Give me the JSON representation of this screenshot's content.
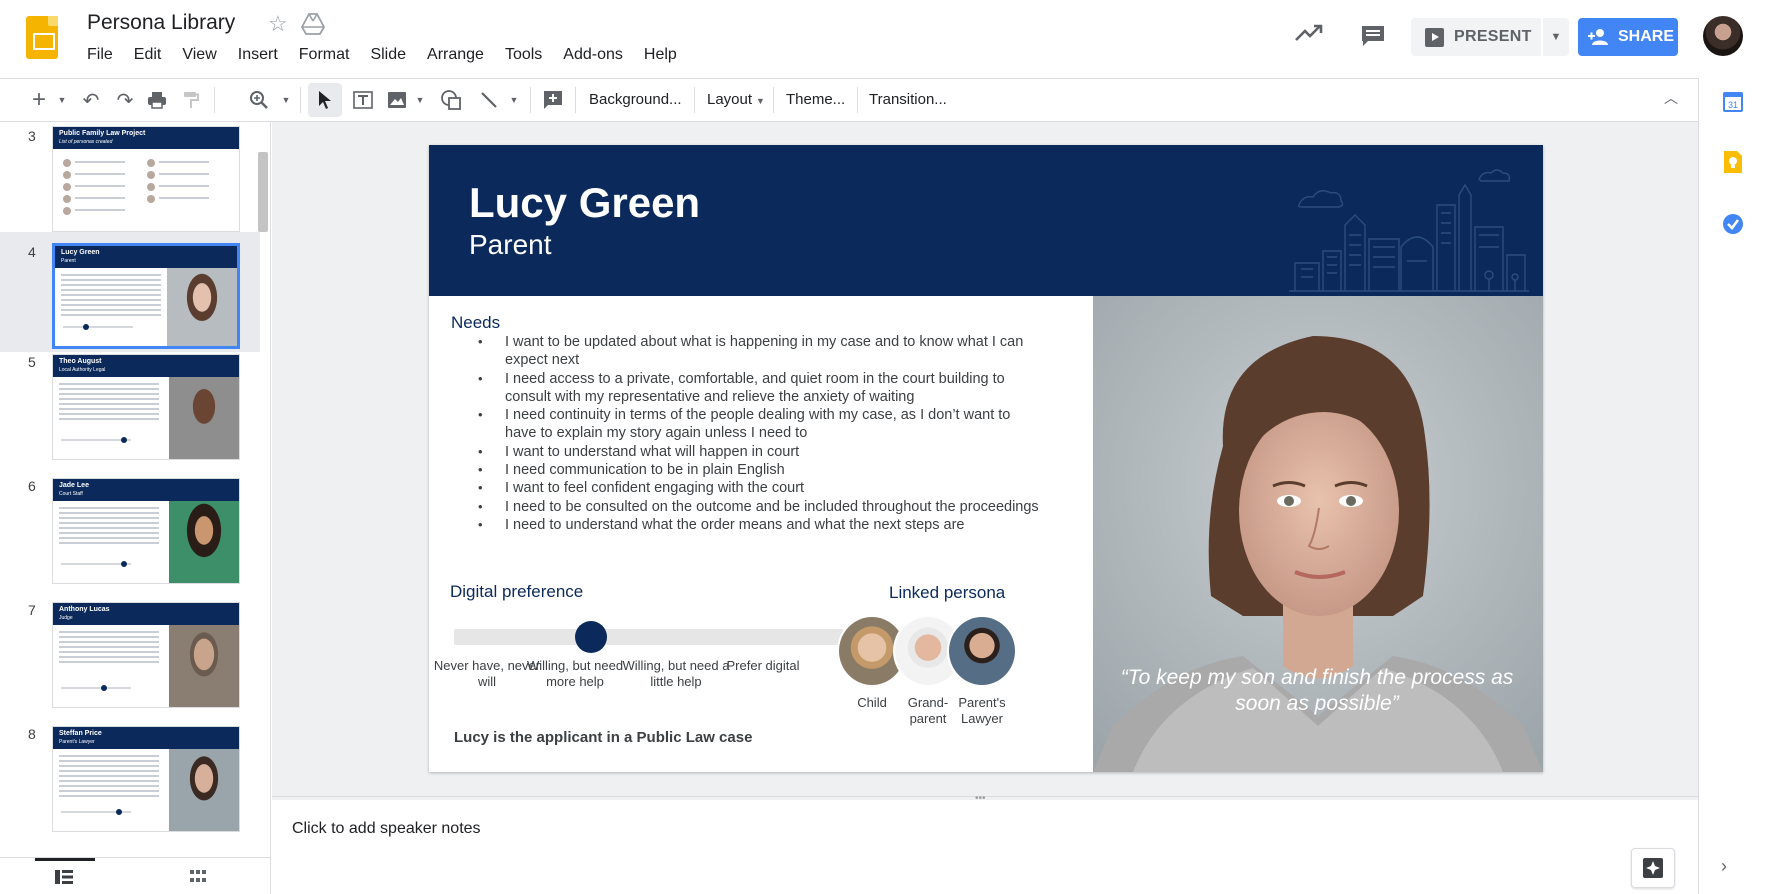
{
  "header": {
    "title": "Persona Library",
    "menu": [
      "File",
      "Edit",
      "View",
      "Insert",
      "Format",
      "Slide",
      "Arrange",
      "Tools",
      "Add-ons",
      "Help"
    ],
    "present_label": "PRESENT",
    "share_label": "SHARE"
  },
  "toolbar": {
    "background_label": "Background...",
    "layout_label": "Layout",
    "theme_label": "Theme...",
    "transition_label": "Transition..."
  },
  "filmstrip": {
    "slides": [
      {
        "number": "3",
        "name": "Public Family Law Project",
        "role": "List of personas created"
      },
      {
        "number": "4",
        "name": "Lucy Green",
        "role": "Parent",
        "selected": true
      },
      {
        "number": "5",
        "name": "Theo August",
        "role": "Local Authority Legal"
      },
      {
        "number": "6",
        "name": "Jade Lee",
        "role": "Court Staff"
      },
      {
        "number": "7",
        "name": "Anthony Lucas",
        "role": "Judge"
      },
      {
        "number": "8",
        "name": "Steffan Price",
        "role": "Parent's Lawyer"
      }
    ]
  },
  "slide": {
    "name": "Lucy Green",
    "role": "Parent",
    "needs_title": "Needs",
    "needs": [
      "I want to be updated about what is happening in my case and to know what I can expect next",
      "I need access to a private, comfortable, and quiet room in the court building to consult with my representative and relieve the anxiety of waiting",
      "I need continuity in terms of the people dealing with my case, as I don’t want to have to explain my story again unless I need to",
      "I want to understand what will happen in court",
      "I need communication to be in plain English",
      "I want to feel confident engaging with the court",
      "I need to be consulted on the outcome and be included throughout the proceedings",
      "I need to understand what the order means and what the next steps are"
    ],
    "digital_title": "Digital preference",
    "digital_scale": [
      "Never have, never will",
      "Willing, but need more help",
      "Willing, but need a little help",
      "Prefer digital"
    ],
    "digital_level": 0.35,
    "applicant_note": "Lucy is the applicant in a Public Law case",
    "linked_title": "Linked persona",
    "linked": [
      "Child",
      "Grand-parent",
      "Parent's Lawyer"
    ],
    "quote": "“To keep my son and finish the process as soon as possible”"
  },
  "notes": {
    "placeholder": "Click to add speaker notes"
  },
  "colors": {
    "brand_navy": "#0b2a5b",
    "share_blue": "#4285f4",
    "slides_yellow": "#f4b400"
  }
}
